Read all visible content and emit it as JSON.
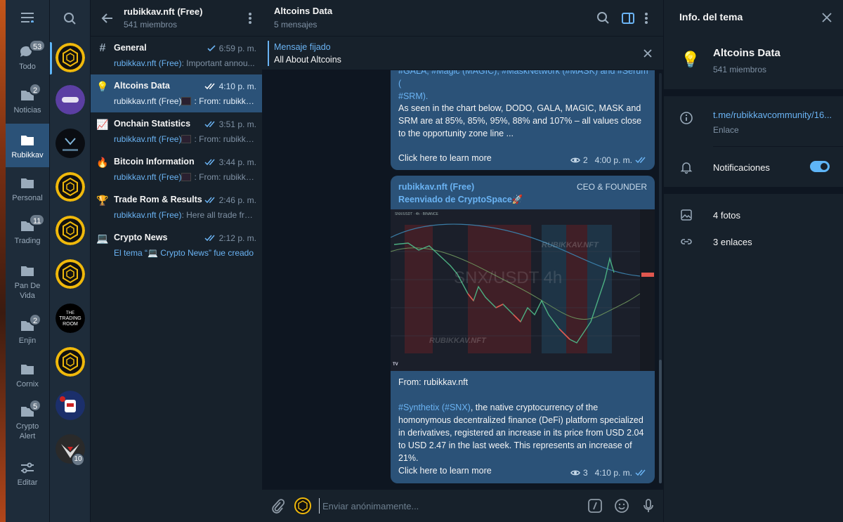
{
  "folders": [
    {
      "label": "Todo",
      "badge": "53",
      "icon": "chat-bubbles-icon"
    },
    {
      "label": "Noticias",
      "badge": "2",
      "icon": "folder-icon"
    },
    {
      "label": "Rubikkav",
      "badge": "",
      "icon": "folder-icon",
      "active": true
    },
    {
      "label": "Personal",
      "badge": "",
      "icon": "folder-icon"
    },
    {
      "label": "Trading",
      "badge": "11",
      "icon": "folder-icon"
    },
    {
      "label": "Pan De Vida",
      "badge": "",
      "icon": "folder-icon"
    },
    {
      "label": "Enjin",
      "badge": "2",
      "icon": "folder-icon"
    },
    {
      "label": "Cornix",
      "badge": "",
      "icon": "folder-icon"
    },
    {
      "label": "Crypto Alert",
      "badge": "5",
      "icon": "folder-icon"
    },
    {
      "label": "Editar",
      "badge": "",
      "icon": "sliders-icon"
    }
  ],
  "avatars": [
    {
      "name": "rubikkav-avatar",
      "active": true
    },
    {
      "name": "cryptospace-avatar"
    },
    {
      "name": "dominando-avatar"
    },
    {
      "name": "rubikkav-avatar-2"
    },
    {
      "name": "rubikkav-avatar-3"
    },
    {
      "name": "rubikkav-avatar-4"
    },
    {
      "name": "the-trading-room-avatar",
      "text": "THE TRADING ROOM"
    },
    {
      "name": "rubikkav-avatar-5"
    },
    {
      "name": "robot-avatar"
    },
    {
      "name": "eagle-avatar",
      "badge": "10"
    }
  ],
  "group": {
    "title": "rubikkav.nft (Free)",
    "members": "541 miembros"
  },
  "topics": [
    {
      "icon": "#",
      "name": "General",
      "time": "6:59 p. m.",
      "check": "single",
      "sender": "rubikkav.nft (Free)",
      "preview": ": Important annou..."
    },
    {
      "icon": "💡",
      "name": "Altcoins Data",
      "time": "4:10 p. m.",
      "check": "double",
      "sender": "rubikkav.nft (Free)",
      "preview": ": From: rubikka...",
      "thumb": true,
      "active": true
    },
    {
      "icon": "📈",
      "name": "Onchain Statistics",
      "time": "3:51 p. m.",
      "check": "double",
      "sender": "rubikkav.nft (Free)",
      "preview": ": From: rubikka...",
      "thumb": true
    },
    {
      "icon": "🔥",
      "name": "Bitcoin Information",
      "time": "3:44 p. m.",
      "check": "double",
      "sender": "rubikkav.nft (Free)",
      "preview": ": From: rubikka...",
      "thumb": true
    },
    {
      "icon": "🏆",
      "name": "Trade Rom & Results",
      "time": "2:46 p. m.",
      "check": "double",
      "sender": "rubikkav.nft (Free)",
      "preview": ": Here all trade free...",
      "thumb": false
    },
    {
      "icon": "💻",
      "name": "Crypto News",
      "time": "2:12 p. m.",
      "check": "double",
      "sender": "",
      "preview": "El tema “💻 Crypto News” fue creado",
      "created": true
    }
  ],
  "chat": {
    "title": "Altcoins Data",
    "subtitle": "5 mensajes",
    "pinned_label": "Mensaje fijado",
    "pinned_text": "All About Altcoins",
    "msg1": {
      "top_text": "#GALA, #Magic (MAGIC), #MaskNetwork (#MASK) and #Serum (",
      "top_text2": "#SRM).",
      "body": "As seen in the chart below, DODO, GALA, MAGIC, MASK and SRM are at 85%, 85%, 95%, 88% and 107% – all values close to the opportunity zone line ...",
      "link": "Click here to learn more",
      "views": "2",
      "time": "4:00 p. m."
    },
    "msg2": {
      "author": "rubikkav.nft (Free)",
      "role": "CEO & FOUNDER",
      "forwarded": "Reenviado de CryptoSpace🚀",
      "chart_title": "SNX/USDT 4h",
      "chart_watermark": "RUBIKKAV.NFT",
      "chart_watermark2": "RUBIKKAV.NFT",
      "chart_header": "SNX/USDT · 4h · BINANCE",
      "from": "From: rubikkav.nft",
      "body_tags": "#Synthetix (#SNX)",
      "body": ", the native cryptocurrency of the homonymous decentralized finance (DeFi) platform specialized in derivatives, registered an increase in its price from USD 2.04 to USD 2.47 in the last week. This represents an increase of 21%.",
      "link": "Click here to learn more",
      "views": "3",
      "time": "4:10 p. m."
    },
    "composer_placeholder": "Enviar anónimamente..."
  },
  "info": {
    "header": "Info. del tema",
    "name": "Altcoins Data",
    "members": "541 miembros",
    "link": "t.me/rubikkavcommunity/16...",
    "link_label": "Enlace",
    "notifications": "Notificaciones",
    "notifications_on": true,
    "photos": "4 fotos",
    "links": "3 enlaces"
  },
  "colors": {
    "accent": "#6ab3f3",
    "bubble": "#2b5278",
    "bg": "#0e1621",
    "panel": "#17212b"
  }
}
